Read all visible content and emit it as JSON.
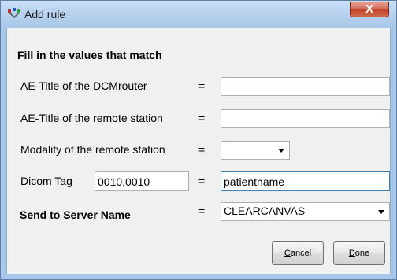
{
  "window": {
    "title": "Add rule",
    "close_glyph": "X"
  },
  "form": {
    "heading": "Fill in the values that match",
    "rows": [
      {
        "label": "AE-Title of the DCMrouter",
        "eq": "=",
        "value": ""
      },
      {
        "label": "AE-Title of the remote station",
        "eq": "=",
        "value": ""
      },
      {
        "label": "Modality of the remote station",
        "eq": "=",
        "value": ""
      }
    ],
    "dicom_tag": {
      "label": "Dicom Tag",
      "tag_value": "0010,0010",
      "eq": "=",
      "value": "patientname"
    },
    "send_to": {
      "label": "Send to Server Name",
      "eq": "=",
      "value": "CLEARCANVAS"
    }
  },
  "buttons": {
    "cancel": {
      "accel": "C",
      "rest": "ancel"
    },
    "done": {
      "accel": "D",
      "rest": "one"
    }
  },
  "icons": {
    "app": "rule-app-icon",
    "dropdown": "chevron-down-icon"
  }
}
